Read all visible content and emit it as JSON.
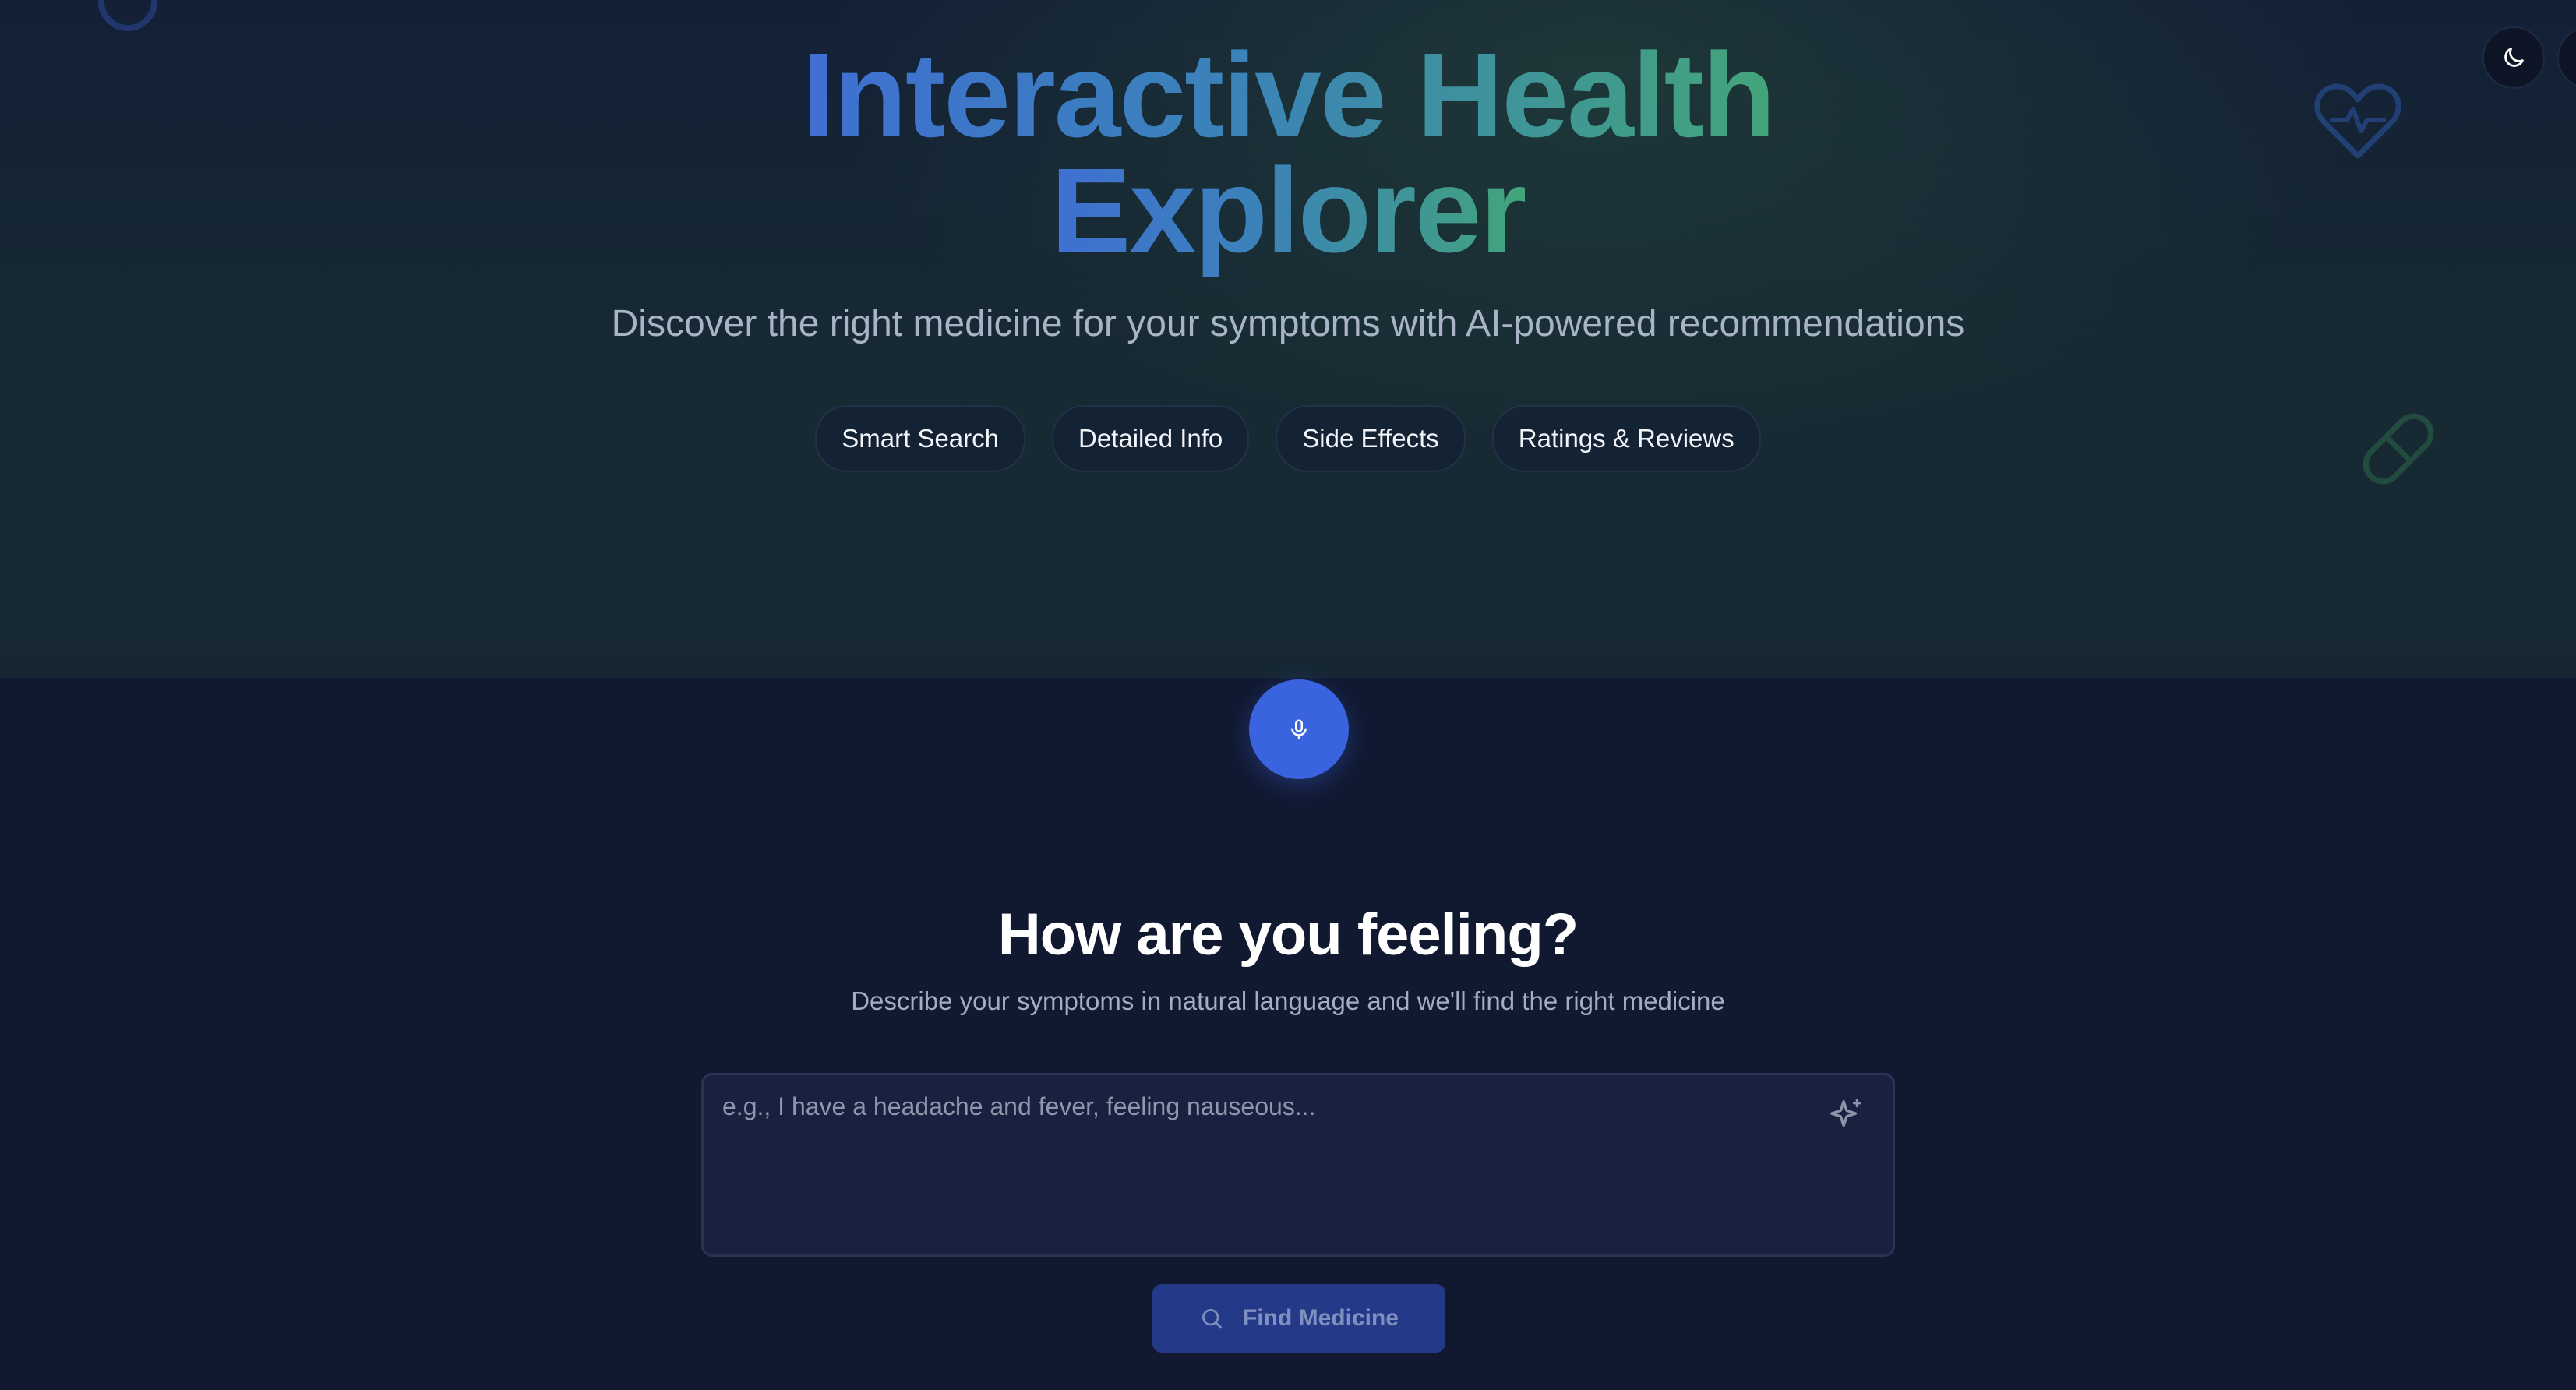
{
  "hero": {
    "title_line1": "Interactive Health",
    "title_line2": "Explorer",
    "subtitle": "Discover the right medicine for your symptoms with AI-powered recommendations",
    "chips": [
      "Smart Search",
      "Detailed Info",
      "Side Effects",
      "Ratings & Reviews"
    ]
  },
  "icons": {
    "mic": "microphone-icon",
    "theme": "moon-icon",
    "sparkle": "sparkle-icon",
    "search": "search-icon",
    "decor": [
      "ring-icon",
      "heart-pulse-icon",
      "pill-icon"
    ]
  },
  "symptoms": {
    "heading": "How are you feeling?",
    "description": "Describe your symptoms in natural language and we'll find the right medicine",
    "input_value": "",
    "placeholder": "e.g., I have a headache and fever, feeling nauseous...",
    "button_label": "Find Medicine"
  },
  "colors": {
    "accent": "#3a63e0",
    "gradient_start": "#3f6fd3",
    "gradient_end": "#43a57a",
    "button_bg": "#243a88"
  }
}
